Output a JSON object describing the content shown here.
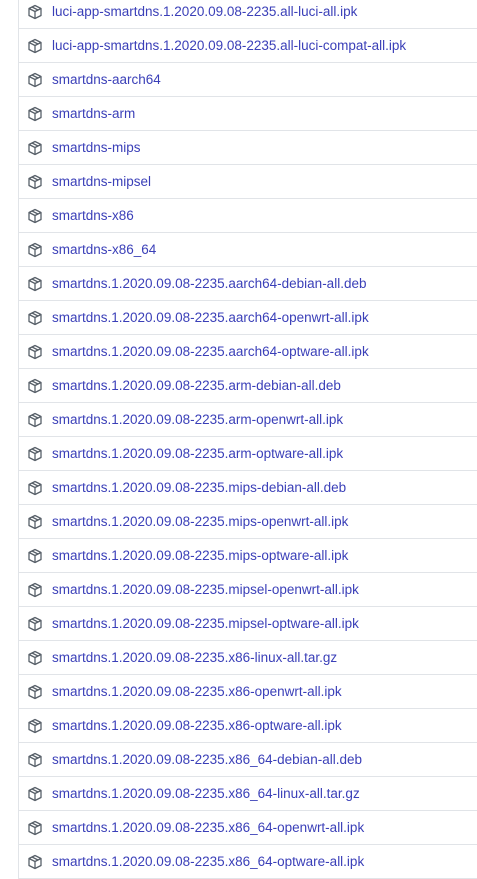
{
  "assets": {
    "icon": "package-icon",
    "link_color": "#3a3fb8",
    "items": [
      "luci-app-smartdns.1.2020.09.08-2235.all-luci-all.ipk",
      "luci-app-smartdns.1.2020.09.08-2235.all-luci-compat-all.ipk",
      "smartdns-aarch64",
      "smartdns-arm",
      "smartdns-mips",
      "smartdns-mipsel",
      "smartdns-x86",
      "smartdns-x86_64",
      "smartdns.1.2020.09.08-2235.aarch64-debian-all.deb",
      "smartdns.1.2020.09.08-2235.aarch64-openwrt-all.ipk",
      "smartdns.1.2020.09.08-2235.aarch64-optware-all.ipk",
      "smartdns.1.2020.09.08-2235.arm-debian-all.deb",
      "smartdns.1.2020.09.08-2235.arm-openwrt-all.ipk",
      "smartdns.1.2020.09.08-2235.arm-optware-all.ipk",
      "smartdns.1.2020.09.08-2235.mips-debian-all.deb",
      "smartdns.1.2020.09.08-2235.mips-openwrt-all.ipk",
      "smartdns.1.2020.09.08-2235.mips-optware-all.ipk",
      "smartdns.1.2020.09.08-2235.mipsel-openwrt-all.ipk",
      "smartdns.1.2020.09.08-2235.mipsel-optware-all.ipk",
      "smartdns.1.2020.09.08-2235.x86-linux-all.tar.gz",
      "smartdns.1.2020.09.08-2235.x86-openwrt-all.ipk",
      "smartdns.1.2020.09.08-2235.x86-optware-all.ipk",
      "smartdns.1.2020.09.08-2235.x86_64-debian-all.deb",
      "smartdns.1.2020.09.08-2235.x86_64-linux-all.tar.gz",
      "smartdns.1.2020.09.08-2235.x86_64-openwrt-all.ipk",
      "smartdns.1.2020.09.08-2235.x86_64-optware-all.ipk"
    ]
  }
}
